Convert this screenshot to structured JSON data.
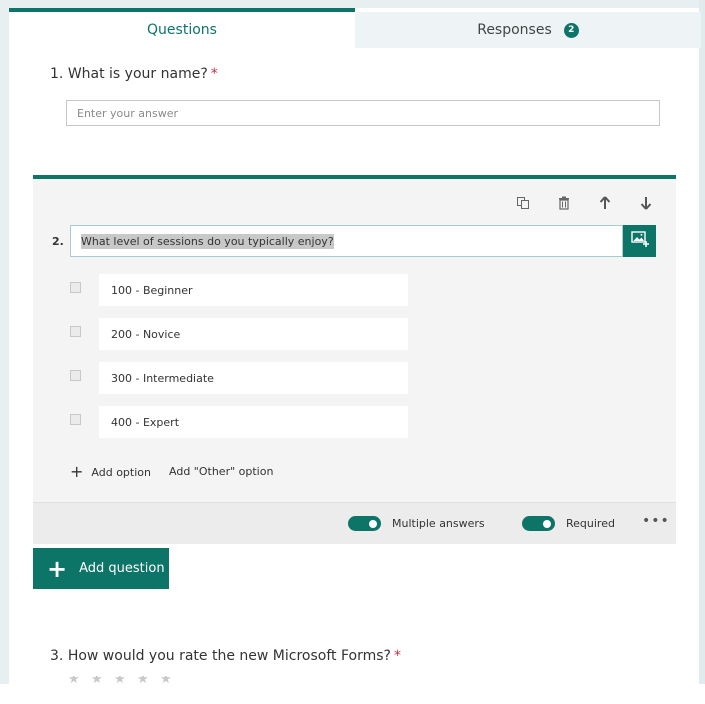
{
  "tabs": {
    "questions": {
      "label": "Questions",
      "active": true
    },
    "responses": {
      "label": "Responses",
      "count": "2"
    }
  },
  "colors": {
    "accent": "#0d7468",
    "required": "#c4314b"
  },
  "questions": [
    {
      "number": "1.",
      "title": "What is your name?",
      "required_mark": "*",
      "type": "text",
      "placeholder": "Enter your answer",
      "value": ""
    },
    {
      "number": "2.",
      "title": "What level of sessions do you typically enjoy?",
      "type": "choice",
      "options": [
        {
          "label": "100 - Beginner",
          "checked": false
        },
        {
          "label": "200 - Novice",
          "checked": false
        },
        {
          "label": "300 - Intermediate",
          "checked": false
        },
        {
          "label": "400 - Expert",
          "checked": false
        }
      ],
      "add_option_label": "Add option",
      "add_other_label": "Add \"Other\" option",
      "toolbar": {
        "copy_icon": "copy-icon",
        "delete_icon": "trash-icon",
        "move_up_icon": "arrow-up-icon",
        "move_down_icon": "arrow-down-icon",
        "insert_media_icon": "image-add-icon"
      },
      "multiple_answers": {
        "label": "Multiple answers",
        "on": true
      },
      "required": {
        "label": "Required",
        "on": true
      },
      "more_label": "•••"
    },
    {
      "number": "3.",
      "title": "How would you rate the new Microsoft Forms?",
      "required_mark": "*",
      "type": "rating",
      "stars": 5
    }
  ],
  "add_question": {
    "label": "Add question"
  }
}
